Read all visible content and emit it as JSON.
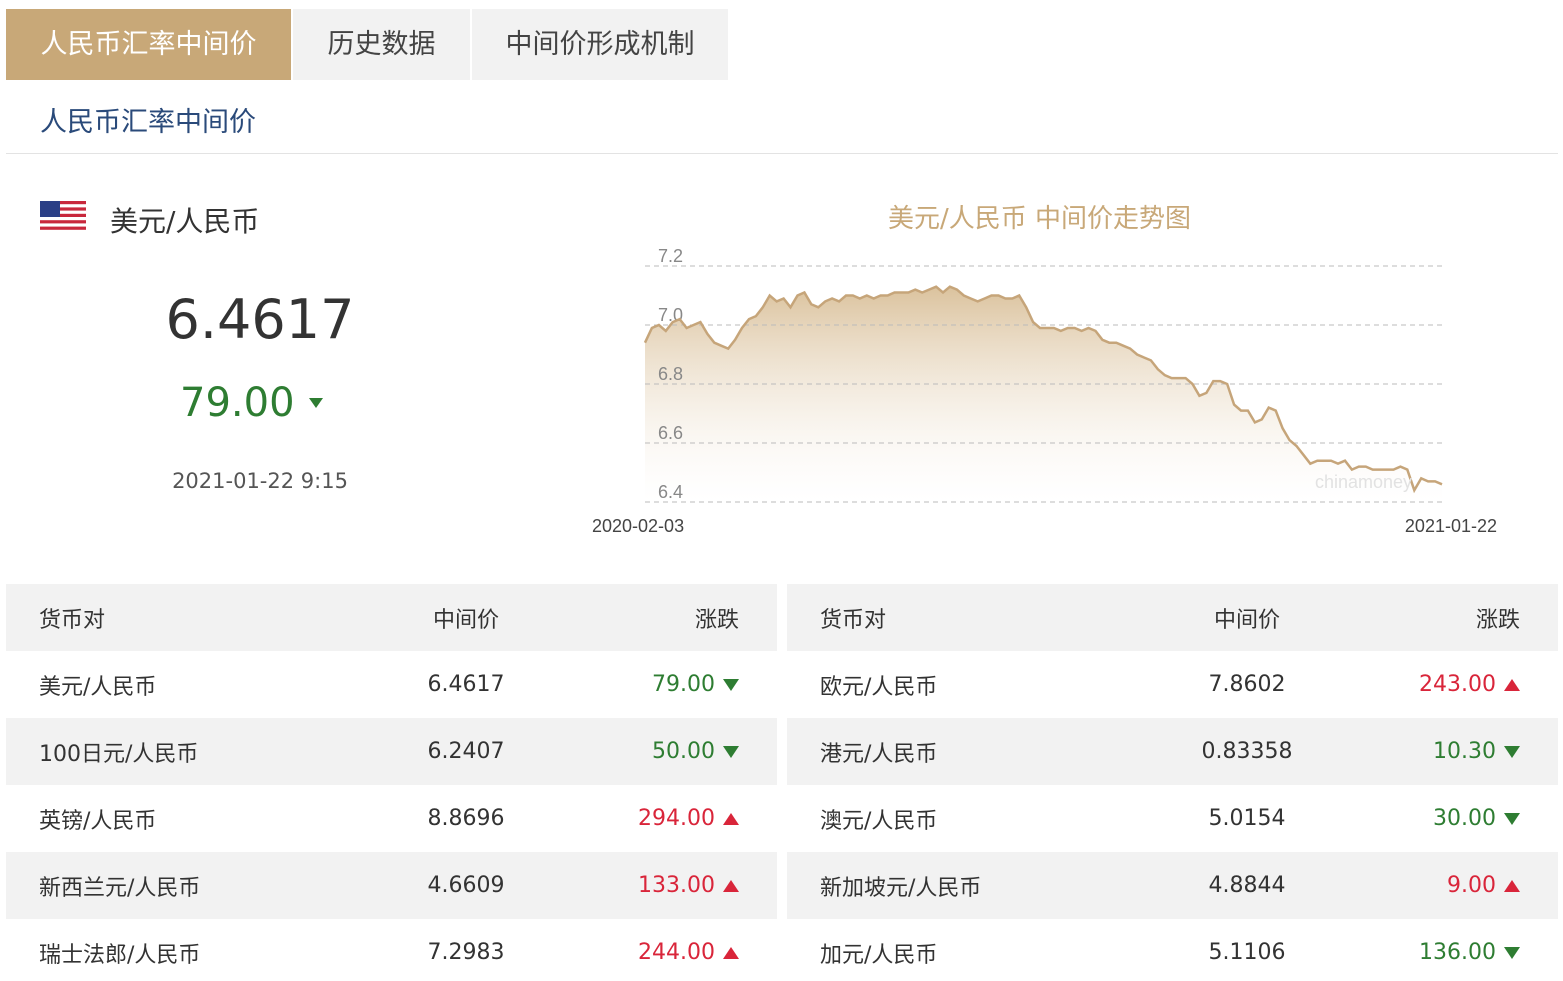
{
  "tabs": [
    {
      "label": "人民币汇率中间价"
    },
    {
      "label": "历史数据"
    },
    {
      "label": "中间价形成机制"
    }
  ],
  "section_title": "人民币汇率中间价",
  "featured": {
    "flag": "us-flag-icon",
    "pair": "美元/人民币",
    "price": "6.4617",
    "change": "79.00",
    "direction": "down",
    "time": "2021-01-22 9:15"
  },
  "chart_data": {
    "type": "area",
    "title": "美元/人民币 中间价走势图",
    "x_start": "2020-02-03",
    "x_end": "2021-01-22",
    "x_labels": [
      "2020-02-03",
      "2021-01-22"
    ],
    "y_ticks": [
      "7.2",
      "7.0",
      "6.8",
      "6.6",
      "6.4"
    ],
    "ylim": [
      6.4,
      7.2
    ],
    "grid": true,
    "watermark": "chinamoney",
    "values": [
      6.94,
      6.99,
      7.0,
      6.98,
      7.01,
      7.02,
      6.99,
      7.0,
      7.01,
      6.97,
      6.94,
      6.93,
      6.92,
      6.95,
      6.99,
      7.02,
      7.03,
      7.06,
      7.1,
      7.08,
      7.09,
      7.06,
      7.1,
      7.11,
      7.07,
      7.06,
      7.08,
      7.09,
      7.08,
      7.1,
      7.1,
      7.09,
      7.1,
      7.09,
      7.1,
      7.1,
      7.11,
      7.11,
      7.11,
      7.12,
      7.11,
      7.12,
      7.13,
      7.11,
      7.13,
      7.12,
      7.1,
      7.09,
      7.08,
      7.09,
      7.1,
      7.1,
      7.09,
      7.09,
      7.1,
      7.06,
      7.01,
      6.99,
      6.99,
      6.99,
      6.98,
      6.99,
      6.99,
      6.98,
      6.99,
      6.98,
      6.95,
      6.94,
      6.94,
      6.93,
      6.92,
      6.9,
      6.89,
      6.88,
      6.85,
      6.83,
      6.82,
      6.82,
      6.82,
      6.8,
      6.76,
      6.77,
      6.81,
      6.81,
      6.8,
      6.73,
      6.71,
      6.71,
      6.67,
      6.68,
      6.72,
      6.71,
      6.65,
      6.61,
      6.59,
      6.56,
      6.53,
      6.54,
      6.54,
      6.54,
      6.53,
      6.54,
      6.51,
      6.52,
      6.52,
      6.51,
      6.51,
      6.51,
      6.51,
      6.52,
      6.51,
      6.44,
      6.48,
      6.47,
      6.47,
      6.46
    ]
  },
  "table_headers": {
    "pair": "货币对",
    "price": "中间价",
    "change": "涨跌"
  },
  "table_left": [
    {
      "pair": "美元/人民币",
      "price": "6.4617",
      "change": "79.00",
      "dir": "down"
    },
    {
      "pair": "100日元/人民币",
      "price": "6.2407",
      "change": "50.00",
      "dir": "down"
    },
    {
      "pair": "英镑/人民币",
      "price": "8.8696",
      "change": "294.00",
      "dir": "up"
    },
    {
      "pair": "新西兰元/人民币",
      "price": "4.6609",
      "change": "133.00",
      "dir": "up"
    },
    {
      "pair": "瑞士法郎/人民币",
      "price": "7.2983",
      "change": "244.00",
      "dir": "up"
    }
  ],
  "table_right": [
    {
      "pair": "欧元/人民币",
      "price": "7.8602",
      "change": "243.00",
      "dir": "up"
    },
    {
      "pair": "港元/人民币",
      "price": "0.83358",
      "change": "10.30",
      "dir": "down"
    },
    {
      "pair": "澳元/人民币",
      "price": "5.0154",
      "change": "30.00",
      "dir": "down"
    },
    {
      "pair": "新加坡元/人民币",
      "price": "4.8844",
      "change": "9.00",
      "dir": "up"
    },
    {
      "pair": "加元/人民币",
      "price": "5.1106",
      "change": "136.00",
      "dir": "down"
    }
  ],
  "colors": {
    "accent": "#c8a878",
    "up": "#d9253a",
    "down": "#2e7d32",
    "title_blue": "#2a4a7a"
  }
}
